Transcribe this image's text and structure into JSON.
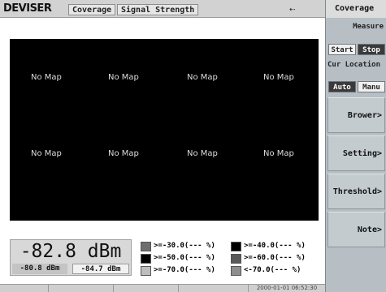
{
  "header": {
    "logo": "DEVISER",
    "tabs": [
      "Coverage",
      "Signal Strength"
    ],
    "usb_icon": "usb-icon"
  },
  "map": {
    "cells": [
      "No Map",
      "No Map",
      "No Map",
      "No Map",
      "No Map",
      "No Map",
      "No Map",
      "No Map"
    ]
  },
  "readout": {
    "value": "-82.8 dBm",
    "min": "-80.8 dBm",
    "max": "-84.7 dBm"
  },
  "legend": [
    {
      "label": ">=-30.0(--- %)",
      "color": "#6e6e6e"
    },
    {
      "label": ">=-40.0(--- %)",
      "color": "#000000"
    },
    {
      "label": ">=-50.0(--- %)",
      "color": "#000000"
    },
    {
      "label": ">=-60.0(--- %)",
      "color": "#5a5a5a"
    },
    {
      "label": ">=-70.0(--- %)",
      "color": "#bdbdbd"
    },
    {
      "label": "<-70.0(--- %)",
      "color": "#8e8e8e"
    }
  ],
  "status": {
    "timestamp": "2000-01-01 06:52:30"
  },
  "panel": {
    "title": "Coverage",
    "measure_label": "Measure",
    "start_label": "Start",
    "stop_label": "Stop",
    "cur_location_label": "Cur Location",
    "auto_label": "Auto",
    "manual_label": "Manu",
    "softkeys": [
      "Brower>",
      "Setting>",
      "Threshold>",
      "Note>"
    ]
  }
}
